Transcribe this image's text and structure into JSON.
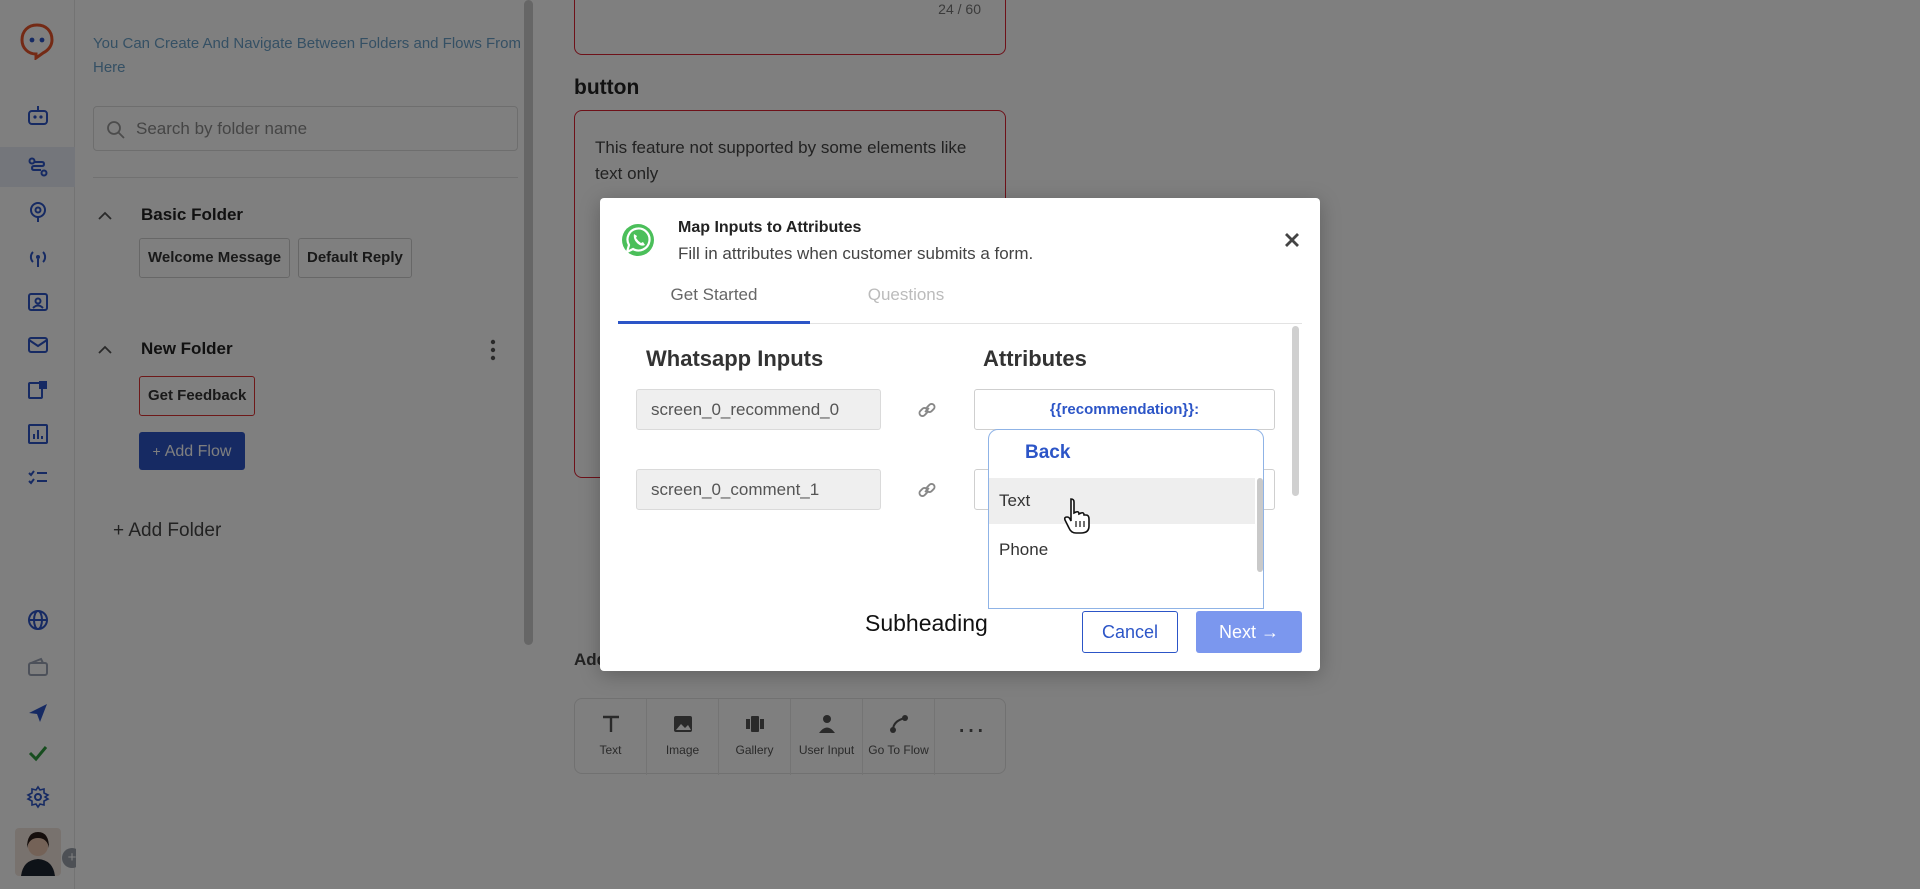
{
  "sidebar": {
    "icons": [
      "logo-icon",
      "bot-icon",
      "flows-icon",
      "brain-icon",
      "broadcast-icon",
      "contacts-icon",
      "mail-icon",
      "campaign-icon",
      "analytics-icon",
      "tasks-icon",
      "globe-icon",
      "wallet-icon",
      "send-icon",
      "check-icon",
      "settings-icon"
    ],
    "active_item": "flows-icon"
  },
  "folders": {
    "hint": "You Can Create And Navigate Between Folders and Flows From Here",
    "search_placeholder": "Search by folder name",
    "basic_folder": {
      "name": "Basic Folder",
      "flows": [
        "Welcome Message",
        "Default Reply"
      ]
    },
    "new_folder": {
      "name": "New Folder",
      "flows": [
        "Get Feedback"
      ]
    },
    "add_flow_label": "Add Flow",
    "add_folder_label": "+ Add Folder"
  },
  "editor": {
    "char_count": "24 / 60",
    "section_label": "button",
    "note": "This feature not supported by some elements like text only",
    "add_label": "Add",
    "tools": [
      "Text",
      "Image",
      "Gallery",
      "User Input",
      "Go To Flow"
    ]
  },
  "modal": {
    "title": "Map Inputs to Attributes",
    "subtitle": "Fill in attributes when customer submits a form.",
    "tabs": [
      "Get Started",
      "Questions"
    ],
    "col_inputs": "Whatsapp Inputs",
    "col_attributes": "Attributes",
    "rows": [
      {
        "input": "screen_0_recommend_0",
        "attribute": "{{recommendation}}:"
      },
      {
        "input": "screen_0_comment_1",
        "attribute": ""
      }
    ],
    "dropdown": {
      "back_label": "Back",
      "options": [
        "Text",
        "Phone"
      ]
    },
    "subheading": "Subheading",
    "cancel_label": "Cancel",
    "next_label": "Next →"
  }
}
